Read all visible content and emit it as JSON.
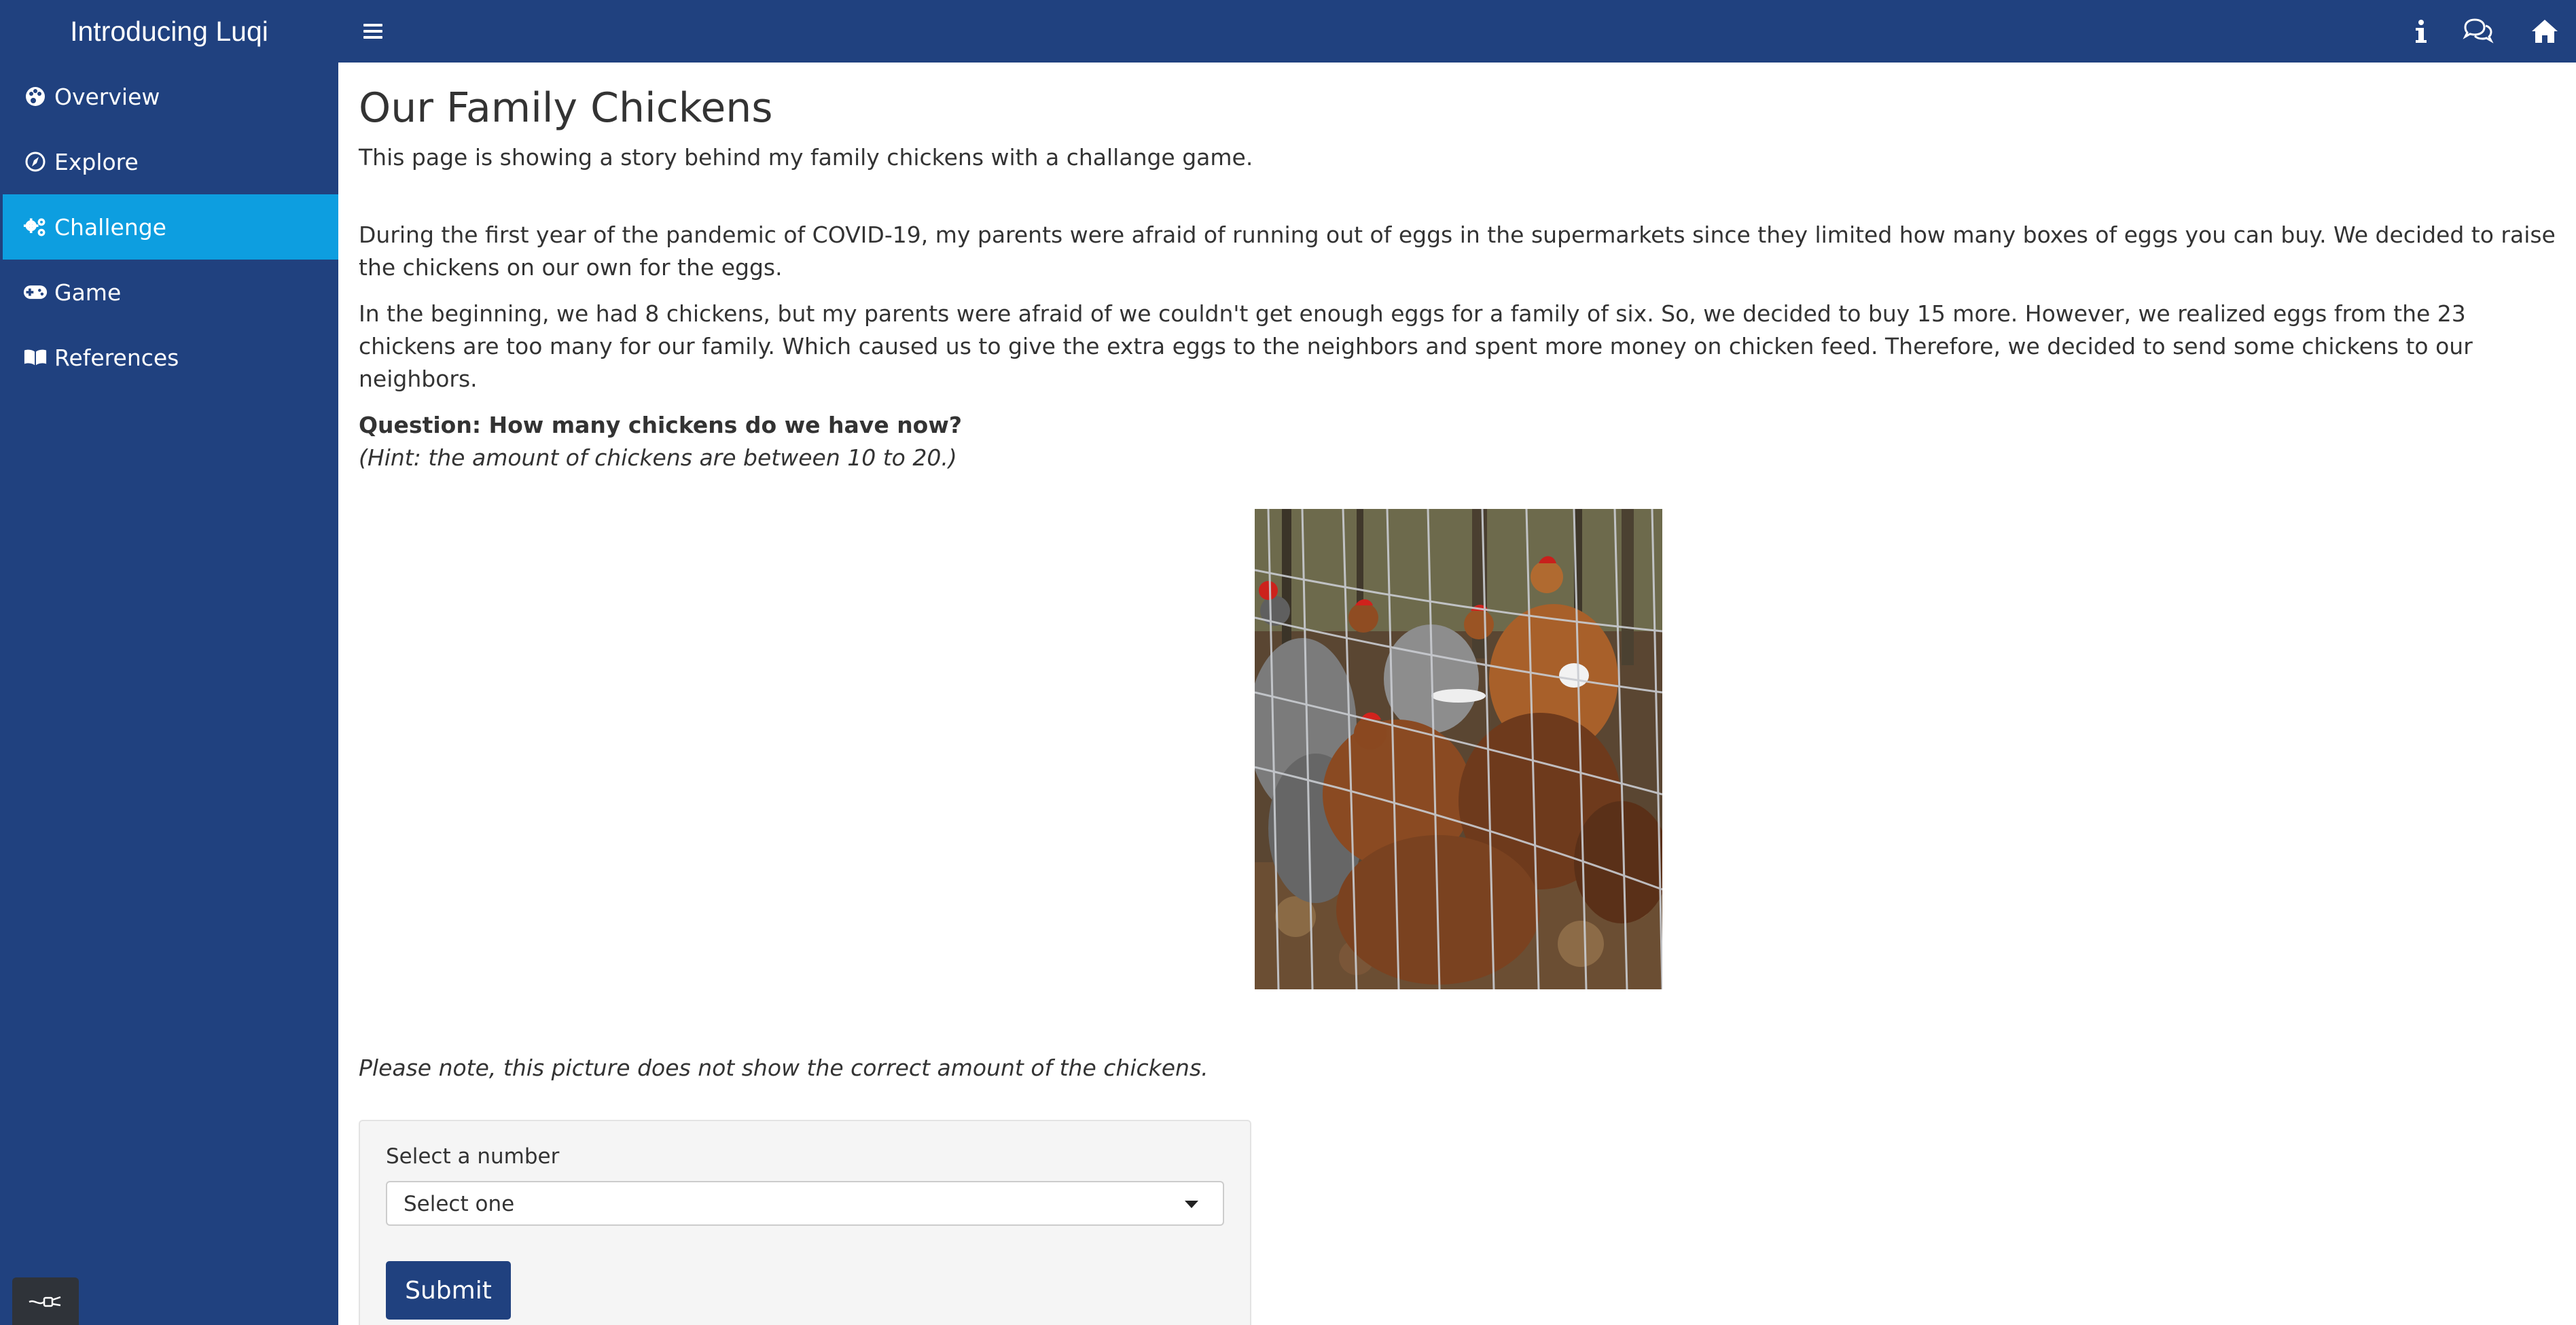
{
  "app": {
    "title": "Introducing Luqi"
  },
  "navbar": {
    "menu_icon": "hamburger-icon",
    "info_icon": "info-icon",
    "comments_icon": "comments-icon",
    "home_icon": "home-icon"
  },
  "sidebar": {
    "items": [
      {
        "label": "Overview",
        "icon": "palette-icon",
        "active": false
      },
      {
        "label": "Explore",
        "icon": "compass-icon",
        "active": false
      },
      {
        "label": "Challenge",
        "icon": "gears-icon",
        "active": true
      },
      {
        "label": "Game",
        "icon": "gamepad-icon",
        "active": false
      },
      {
        "label": "References",
        "icon": "book-open-icon",
        "active": false
      }
    ],
    "toggle_icon": "plug-icon"
  },
  "main": {
    "title": "Our Family Chickens",
    "subtitle": "This page is showing a story behind my family chickens with a challange game.",
    "paragraph1": "During the first year of the pandemic of COVID-19, my parents were afraid of running out of eggs in the supermarkets since they limited how many boxes of eggs you can buy. We decided to raise the chickens on our own for the eggs.",
    "paragraph2": "In the beginning, we had 8 chickens, but my parents were afraid of we couldn't get enough eggs for a family of six. So, we decided to buy 15 more. However, we realized eggs from the 23 chickens are too many for our family. Which caused us to give the extra eggs to the neighbors and spent more money on chicken feed. Therefore, we decided to send some chickens to our neighbors.",
    "question": "Question: How many chickens do we have now?",
    "hint": "(Hint: the amount of chickens are between 10 to 20.)",
    "note": "Please note, this picture does not show the correct amount of the chickens."
  },
  "form": {
    "label": "Select a number",
    "select_value": "Select one",
    "submit_label": "Submit"
  },
  "colors": {
    "navbar": "#20417f",
    "sidebar": "#20417f",
    "active_item": "#0d9ee0",
    "submit_button": "#20417f"
  }
}
